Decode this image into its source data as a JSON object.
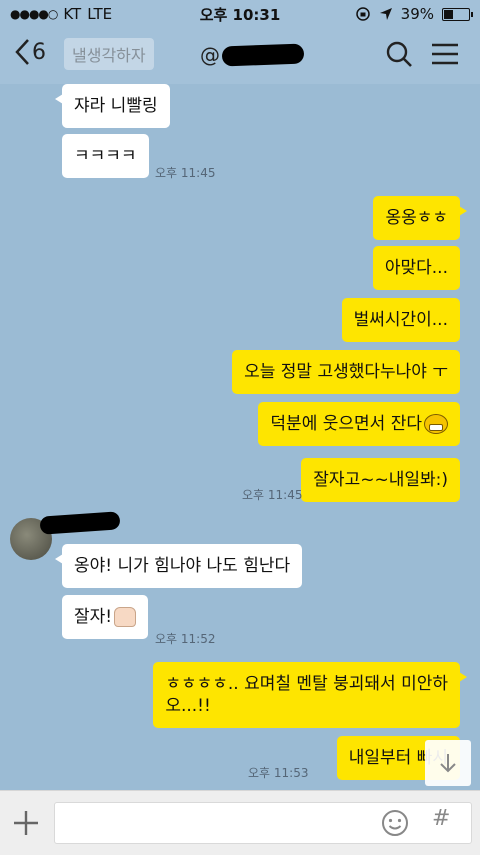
{
  "status": {
    "carrier": "KT",
    "network": "LTE",
    "time": "오후 10:31",
    "battery": "39%",
    "battery_level": 0.39
  },
  "nav": {
    "back_count": "6",
    "prev_preview": "낼생각하자",
    "title_prefix": "@"
  },
  "messages": [
    {
      "side": "in",
      "text": "쟈라 니빨링"
    },
    {
      "side": "in",
      "text": "ㅋㅋㅋㅋ",
      "time": "오후 11:45"
    },
    {
      "side": "out",
      "text": "옹옹ㅎㅎ"
    },
    {
      "side": "out",
      "text": "아맞다..."
    },
    {
      "side": "out",
      "text": "벌써시간이..."
    },
    {
      "side": "out",
      "text": "오늘 정말 고생했다누나야 ㅜ"
    },
    {
      "side": "out",
      "text": "덕분에 웃으면서 잔다"
    },
    {
      "side": "out",
      "text": "잘자고~~내일봐:)",
      "time": "오후 11:45"
    },
    {
      "side": "in",
      "text": "옹야! 니가 힘나야 나도 힘난다"
    },
    {
      "side": "in",
      "text": "잘자!",
      "time": "오후 11:52"
    },
    {
      "side": "out",
      "text_line1": "ㅎㅎㅎㅎ.. 요며칠 멘탈 붕괴돼서 미안하",
      "text_line2": "오...!!"
    },
    {
      "side": "out",
      "text": "내일부터 빠시",
      "time": "오후 11:53"
    }
  ],
  "input": {
    "placeholder": "",
    "hash_label": "#"
  },
  "colors": {
    "background": "#9bbbd4",
    "outgoing_bubble": "#fee500",
    "incoming_bubble": "#ffffff"
  }
}
